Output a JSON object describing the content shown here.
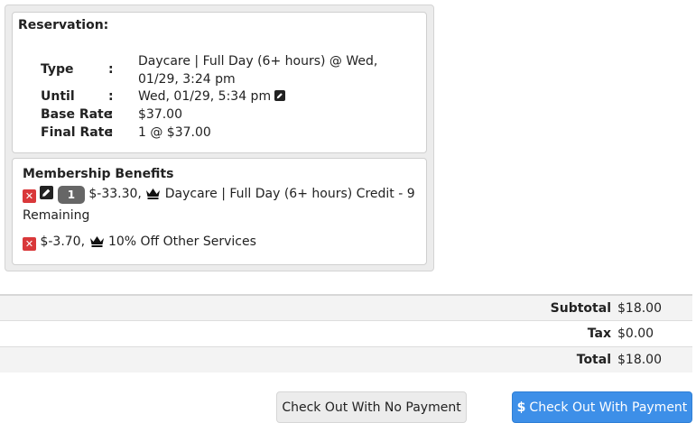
{
  "reservation": {
    "title": "Reservation:",
    "rows": [
      {
        "label": "Type",
        "colon": ":",
        "value": "Daycare | Full Day (6+ hours) @ Wed, 01/29, 3:24 pm"
      },
      {
        "label": "Until",
        "colon": ":",
        "value": "Wed, 01/29, 5:34 pm"
      },
      {
        "label": "Base Rate",
        "colon": ":",
        "value": "$37.00"
      },
      {
        "label": "Final Rate",
        "colon": ":",
        "value": "1 @ $37.00"
      }
    ]
  },
  "membership": {
    "title": "Membership Benefits",
    "benefits": [
      {
        "count": "1",
        "amount": "$-33.30,",
        "description": "Daycare | Full Day (6+ hours) Credit - 9",
        "description_cont": "Remaining"
      },
      {
        "amount": "$-3.70,",
        "description": "10% Off Other Services"
      }
    ]
  },
  "totals": [
    {
      "label": "Subtotal",
      "value": "$18.00"
    },
    {
      "label": "Tax",
      "value": "$0.00"
    },
    {
      "label": "Total",
      "value": "$18.00"
    }
  ],
  "buttons": {
    "no_payment": "Check Out With No Payment",
    "payment_symbol": "$",
    "payment": "Check Out With Payment"
  },
  "colors": {
    "remove": "#d9383a",
    "primary": "#3d8fe8"
  },
  "icons": [
    "close-icon",
    "edit-icon",
    "crown-icon",
    "dollar-icon"
  ]
}
